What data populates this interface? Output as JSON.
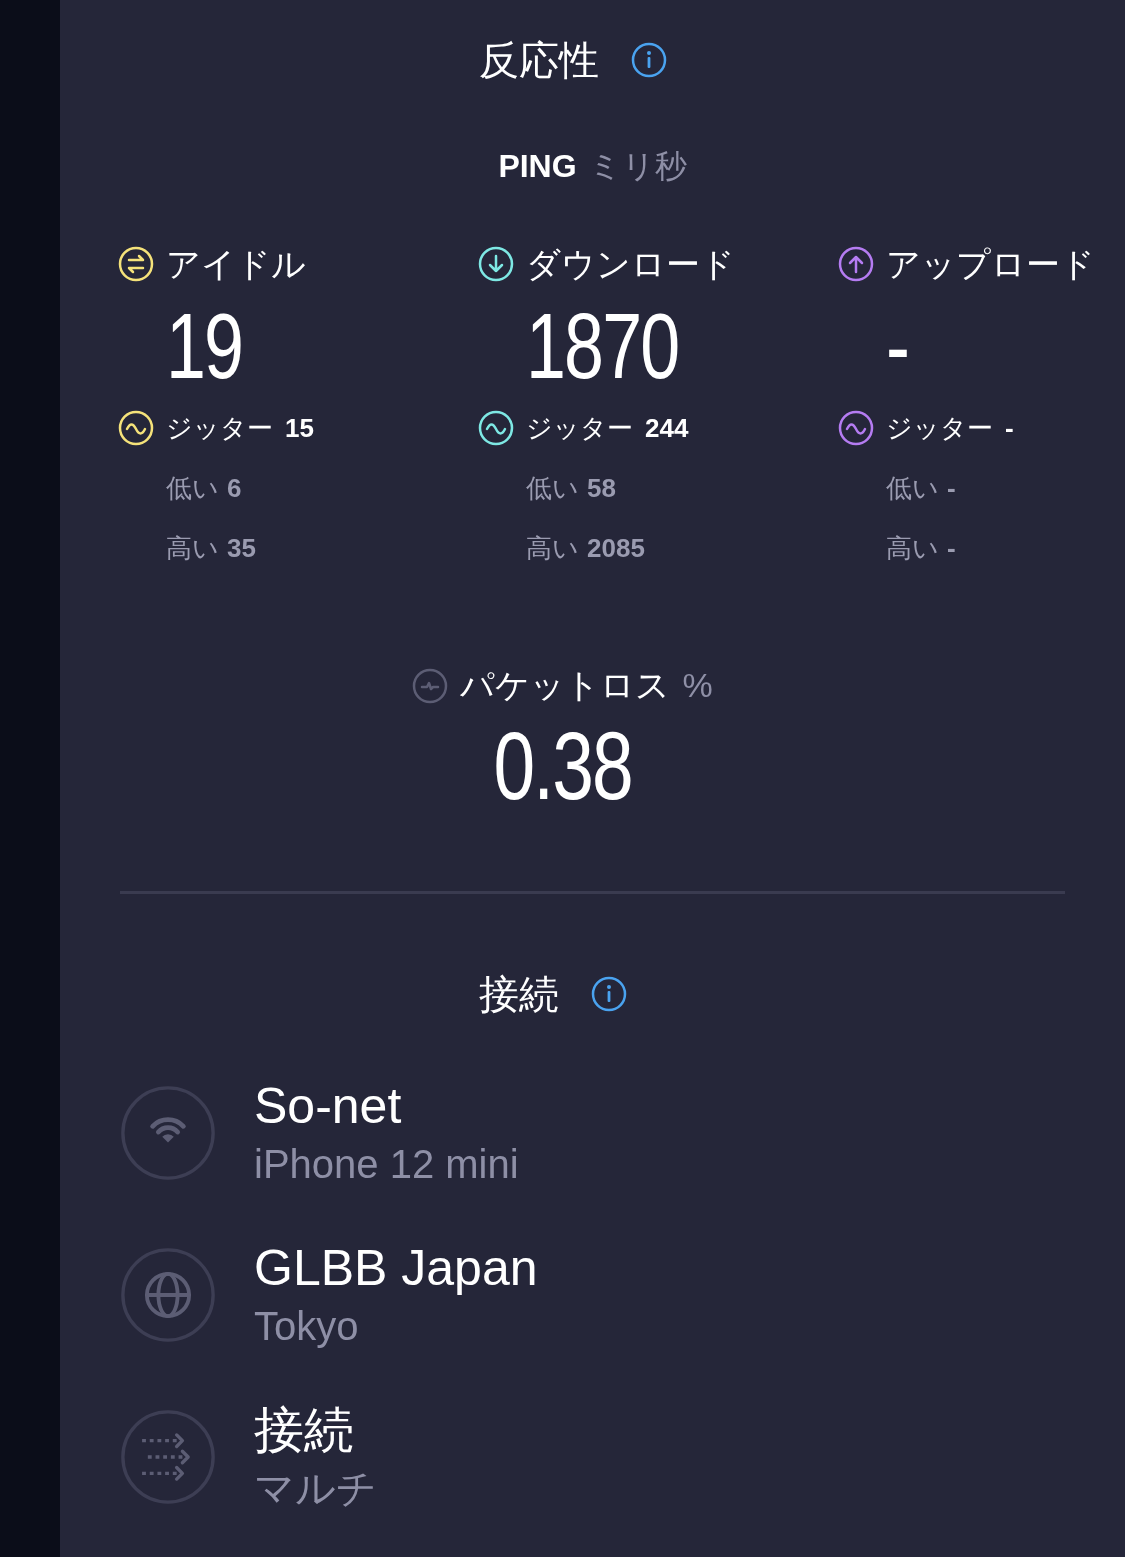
{
  "responsiveness": {
    "title": "反応性",
    "ping_label": "PING",
    "ping_unit": "ミリ秒"
  },
  "metrics": [
    {
      "kind": "idle",
      "color": "#f5e27a",
      "label": "アイドル",
      "value": "19",
      "jitter_label": "ジッター",
      "jitter": "15",
      "low_label": "低い",
      "low": "6",
      "high_label": "高い",
      "high": "35"
    },
    {
      "kind": "download",
      "color": "#7ee8e4",
      "label": "ダウンロード",
      "value": "1870",
      "jitter_label": "ジッター",
      "jitter": "244",
      "low_label": "低い",
      "low": "58",
      "high_label": "高い",
      "high": "2085"
    },
    {
      "kind": "upload",
      "color": "#b57cf2",
      "label": "アップロード",
      "value": "-",
      "jitter_label": "ジッター",
      "jitter": "-",
      "low_label": "低い",
      "low": "-",
      "high_label": "高い",
      "high": "-"
    }
  ],
  "packet_loss": {
    "label": "パケットロス",
    "unit": "%",
    "value": "0.38"
  },
  "connections": {
    "title": "接続",
    "items": [
      {
        "kind": "wifi",
        "name": "So-net",
        "detail": "iPhone 12 mini"
      },
      {
        "kind": "globe",
        "name": "GLBB Japan",
        "detail": "Tokyo"
      },
      {
        "kind": "multi",
        "name": "接続",
        "detail": "マルチ"
      }
    ]
  }
}
